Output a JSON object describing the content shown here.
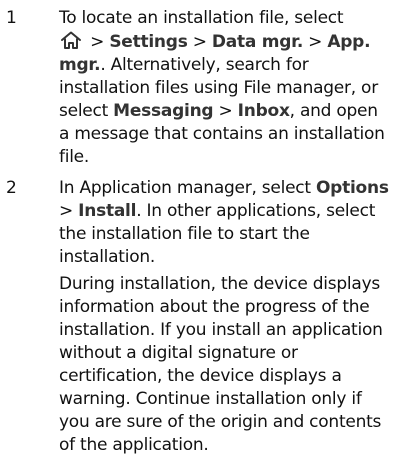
{
  "steps": [
    {
      "number": "1",
      "text": {
        "t1": "To locate an installation file, select",
        "sep1": " > ",
        "settings": "Settings",
        "sep2": " > ",
        "data_mgr": "Data mgr.",
        "sep3": " > ",
        "app_mgr": "App. mgr.",
        "t2": ". Alternatively, search for installation files using File manager, or select ",
        "messaging": "Messaging",
        "sep4": " > ",
        "inbox": "Inbox",
        "t3": ", and open a message that contains an installation file."
      },
      "icon": "home-icon"
    },
    {
      "number": "2",
      "text": {
        "t1": "In Application manager, select ",
        "options": "Options",
        "sep1": " > ",
        "install": "Install",
        "t2": ". In other applications, select the installation file to start the installation."
      },
      "paragraph2": "During installation, the device displays information about the progress of the installation. If you install an application without a digital signature or certification, the device displays a warning. Continue installation only if you are sure of the origin and contents of the application."
    }
  ]
}
